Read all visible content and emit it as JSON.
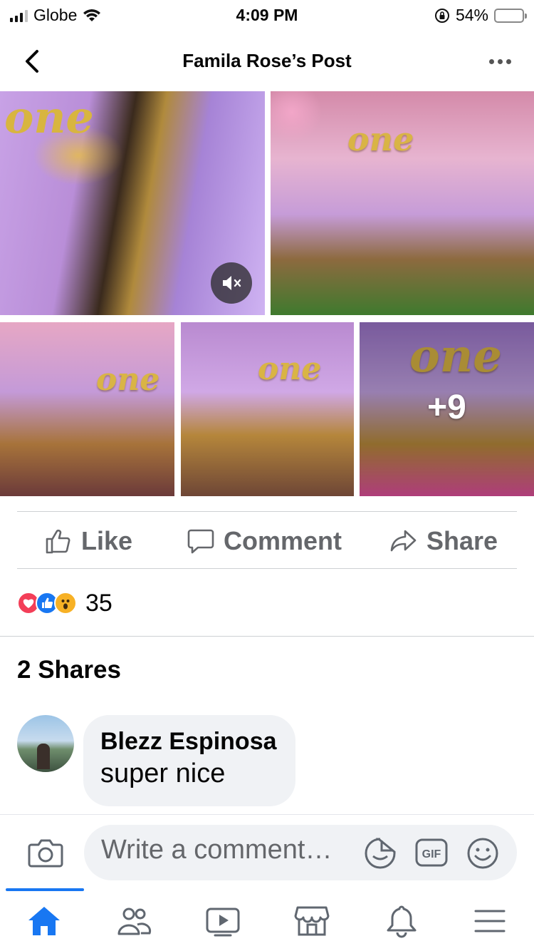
{
  "status_bar": {
    "carrier": "Globe",
    "time": "4:09 PM",
    "battery_percent": "54%",
    "battery_level": 0.54,
    "icons": [
      "signal-icon",
      "wifi-icon",
      "orientation-lock-icon",
      "battery-icon"
    ]
  },
  "header": {
    "title": "Famila Rose’s Post",
    "icons": [
      "back-arrow-icon",
      "more-options-icon"
    ]
  },
  "photos": {
    "more_count": "+9",
    "items": [
      {
        "type": "video",
        "caption_art": "one"
      },
      {
        "type": "photo",
        "caption_art": "one"
      },
      {
        "type": "photo",
        "caption_art": "one"
      },
      {
        "type": "photo",
        "caption_art": "one"
      },
      {
        "type": "photo",
        "caption_art": "one"
      }
    ],
    "video_icon": "muted-speaker-icon"
  },
  "actions": {
    "like": "Like",
    "comment": "Comment",
    "share": "Share"
  },
  "reactions": {
    "types": [
      "love",
      "like",
      "wow"
    ],
    "count": "35"
  },
  "shares": {
    "label": "2 Shares"
  },
  "comments": [
    {
      "author": "Blezz Espinosa",
      "text": "super nice"
    }
  ],
  "composer": {
    "placeholder": "Write a comment…",
    "icons": [
      "camera-icon",
      "sticker-icon",
      "gif-icon",
      "emoji-icon"
    ]
  },
  "bottom_nav": {
    "items": [
      "home-icon",
      "friends-icon",
      "watch-icon",
      "marketplace-icon",
      "notifications-icon",
      "menu-icon"
    ],
    "active": "home-icon"
  },
  "colors": {
    "facebook_blue": "#1877f2",
    "love_red": "#f33e58",
    "wow_yellow": "#f7b125",
    "battery_yellow": "#f5c518",
    "secondary_text": "#65676b"
  }
}
